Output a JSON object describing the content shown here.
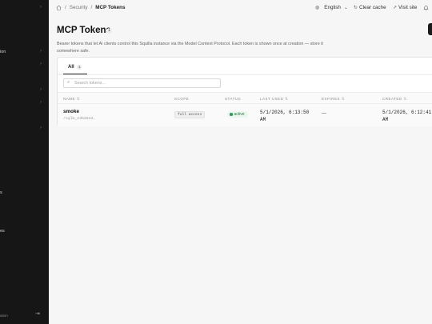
{
  "sidebar": {
    "items": [
      {
        "label": "",
        "chevron": "›"
      },
      {
        "label": "ion",
        "chevron": "›"
      },
      {
        "label": "",
        "chevron": "›"
      },
      {
        "label": "",
        "chevron": "›"
      },
      {
        "label": "",
        "chevron": "›"
      },
      {
        "label": "",
        "chevron": "›"
      },
      {
        "label": "s",
        "chevron": ""
      },
      {
        "label": "es",
        "chevron": ""
      }
    ],
    "footer_text": "ation",
    "logout_icon": "logout-icon"
  },
  "breadcrumb": {
    "home_icon": "home-icon",
    "separator": "/",
    "items": [
      "Security",
      "MCP Tokens"
    ]
  },
  "topbar": {
    "language": "English",
    "clear_cache": "Clear cache",
    "visit_site": "Visit site"
  },
  "page": {
    "title": "MCP Tokens",
    "count": "1",
    "description": "Bearer tokens that let AI clients control this Squilla instance via the Model Context Protocol. Each token is shown once at creation — store it somewhere safe."
  },
  "tabs": [
    {
      "label": "All",
      "count": "1"
    }
  ],
  "search": {
    "placeholder": "Search tokens..."
  },
  "table": {
    "columns": [
      "NAME",
      "SCOPE",
      "STATUS",
      "LAST USED",
      "EXPIRES",
      "CREATED"
    ],
    "sort_glyph": "⇅",
    "rows": [
      {
        "name": "smoke",
        "token_id": "/sqlm_e4b2643…",
        "scope": "full access",
        "status": "active",
        "last_used": "5/1/2026, 6:13:50 AM",
        "expires": "—",
        "created": "5/1/2026, 6:12:41 AM"
      }
    ]
  },
  "colors": {
    "sidebar_bg": "#161616",
    "page_bg": "#f6f6f6",
    "status_active": "#2e9a57"
  }
}
